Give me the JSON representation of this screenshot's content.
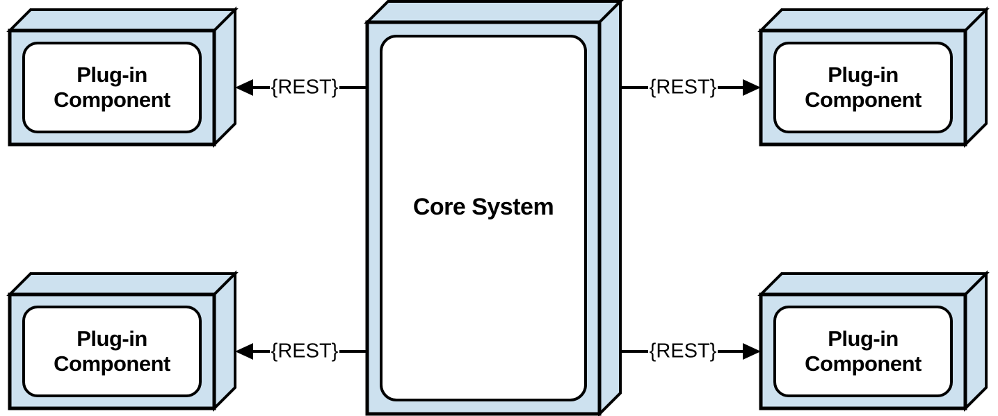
{
  "core": {
    "label": "Core System"
  },
  "plugins": {
    "top_left": {
      "line1": "Plug-in",
      "line2": "Component"
    },
    "bottom_left": {
      "line1": "Plug-in",
      "line2": "Component"
    },
    "top_right": {
      "line1": "Plug-in",
      "line2": "Component"
    },
    "bottom_right": {
      "line1": "Plug-in",
      "line2": "Component"
    }
  },
  "connectors": {
    "top_left": {
      "label": "{REST}"
    },
    "bottom_left": {
      "label": "{REST}"
    },
    "top_right": {
      "label": "{REST}"
    },
    "bottom_right": {
      "label": "{REST}"
    }
  },
  "colors": {
    "box_fill": "#cde1ef",
    "stroke": "#000000",
    "inner_fill": "#ffffff"
  }
}
